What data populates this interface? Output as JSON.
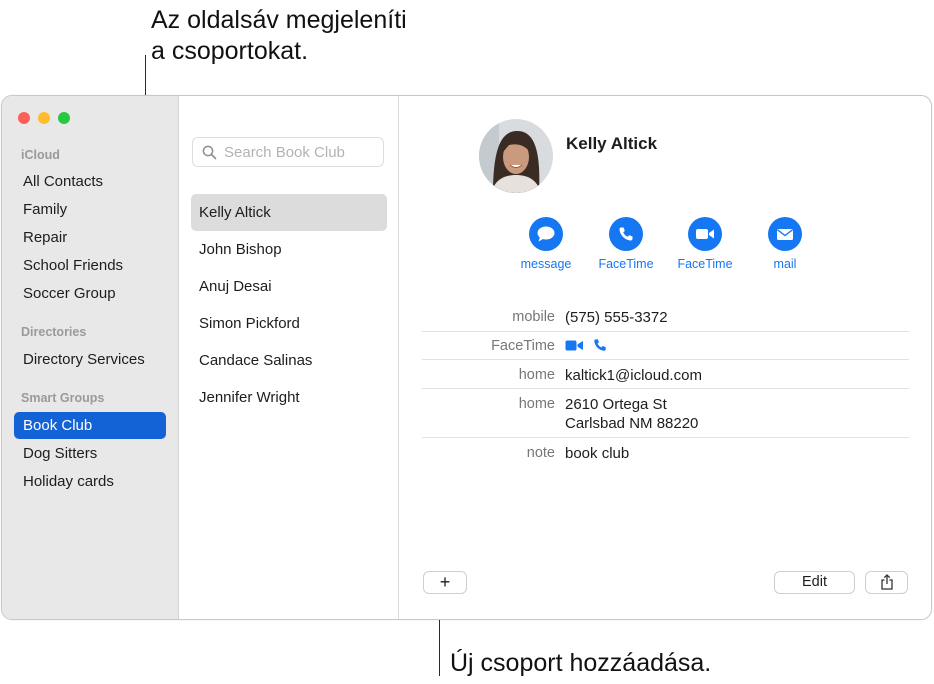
{
  "annotations": {
    "sidebar_callout_line1": "Az oldalsáv megjeleníti",
    "sidebar_callout_line2": "a csoportokat.",
    "add_group_callout": "Új csoport hozzáadása."
  },
  "sidebar": {
    "sections": [
      {
        "title": "iCloud",
        "items": [
          "All Contacts",
          "Family",
          "Repair",
          "School Friends",
          "Soccer Group"
        ]
      },
      {
        "title": "Directories",
        "items": [
          "Directory Services"
        ]
      },
      {
        "title": "Smart Groups",
        "items": [
          "Book Club",
          "Dog Sitters",
          "Holiday cards"
        ]
      }
    ],
    "selected": "Book Club"
  },
  "search": {
    "placeholder": "Search Book Club",
    "value": ""
  },
  "contacts": [
    "Kelly Altick",
    "John Bishop",
    "Anuj Desai",
    "Simon Pickford",
    "Candace Salinas",
    "Jennifer Wright"
  ],
  "selected_contact": "Kelly Altick",
  "card": {
    "name": "Kelly Altick",
    "actions": [
      {
        "label": "message",
        "icon": "message-bubble-icon"
      },
      {
        "label": "FaceTime",
        "icon": "phone-icon"
      },
      {
        "label": "FaceTime",
        "icon": "video-camera-icon"
      },
      {
        "label": "mail",
        "icon": "envelope-icon"
      }
    ],
    "fields": {
      "mobile_label": "mobile",
      "mobile_value": "(575) 555-3372",
      "facetime_label": "FaceTime",
      "email_label": "home",
      "email_value": "kaltick1@icloud.com",
      "address_label": "home",
      "address_line1": "2610 Ortega St",
      "address_line2": "Carlsbad NM 88220",
      "note_label": "note",
      "note_value": "book club"
    }
  },
  "toolbar": {
    "add_label": "+",
    "edit_label": "Edit",
    "share_icon": "share-icon"
  },
  "colors": {
    "accent": "#1677f3",
    "sidebar_selection": "#1463d6",
    "close": "#fe5f57",
    "minimize": "#febc2e",
    "zoom": "#28c840"
  }
}
